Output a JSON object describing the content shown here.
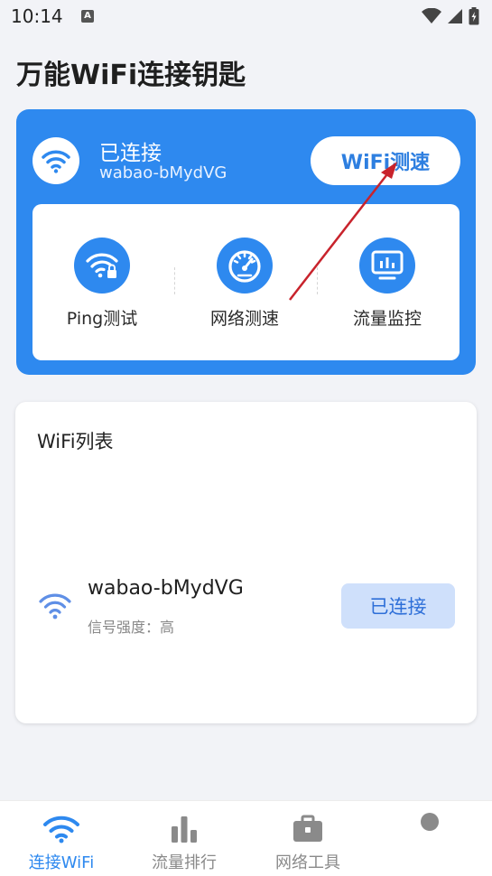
{
  "status_bar": {
    "time": "10:14",
    "notification_badge": "A"
  },
  "app": {
    "title": "万能WiFi连接钥匙"
  },
  "connection": {
    "status": "已连接",
    "ssid": "wabao-bMydVG",
    "speed_test_button": "WiFi测速"
  },
  "tools": [
    {
      "label": "Ping测试",
      "icon": "wifi-lock-icon"
    },
    {
      "label": "网络测速",
      "icon": "speedometer-icon"
    },
    {
      "label": "流量监控",
      "icon": "monitor-chart-icon"
    }
  ],
  "wifi_list": {
    "title": "WiFi列表",
    "items": [
      {
        "ssid": "wabao-bMydVG",
        "signal": "信号强度：高",
        "action": "已连接"
      }
    ]
  },
  "bottom_nav": [
    {
      "label": "连接WiFi",
      "icon": "wifi-icon",
      "active": true
    },
    {
      "label": "流量排行",
      "icon": "bar-chart-icon",
      "active": false
    },
    {
      "label": "网络工具",
      "icon": "toolbox-icon",
      "active": false
    },
    {
      "label": "",
      "icon": "dot-icon",
      "active": false
    }
  ],
  "colors": {
    "primary": "#2e89ef",
    "background": "#f2f3f7",
    "annotation_arrow": "#c8232c"
  }
}
